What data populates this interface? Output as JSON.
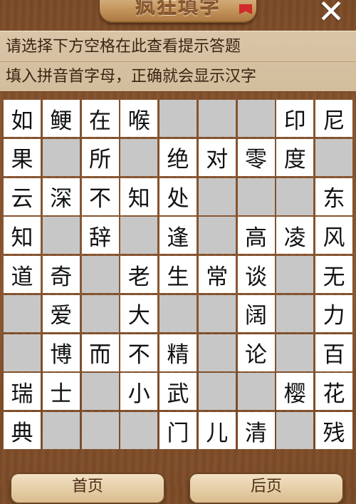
{
  "header": {
    "title": "疯狂填字",
    "close_label": "✕"
  },
  "hints": {
    "line1": "请选择下方空格在此查看提示答题",
    "line2": "填入拼音首字母，正确就会显示汉字"
  },
  "board": {
    "rows": [
      [
        "如",
        "鲠",
        "在",
        "喉",
        "",
        "",
        "",
        "印",
        "尼"
      ],
      [
        "果",
        "",
        "所",
        "",
        "绝",
        "对",
        "零",
        "度",
        ""
      ],
      [
        "云",
        "深",
        "不",
        "知",
        "处",
        "",
        "",
        "",
        "东"
      ],
      [
        "知",
        "",
        "辞",
        "",
        "逢",
        "",
        "高",
        "凌",
        "风"
      ],
      [
        "道",
        "奇",
        "",
        "老",
        "生",
        "常",
        "谈",
        "",
        "无"
      ],
      [
        "",
        "爱",
        "",
        "大",
        "",
        "",
        "阔",
        "",
        "力"
      ],
      [
        "",
        "博",
        "而",
        "不",
        "精",
        "",
        "论",
        "",
        "百"
      ],
      [
        "瑞",
        "士",
        "",
        "小",
        "武",
        "",
        "",
        "樱",
        "花"
      ],
      [
        "典",
        "",
        "",
        "",
        "门",
        "儿",
        "清",
        "",
        "残"
      ]
    ],
    "empty_cells": [
      [
        0,
        4
      ],
      [
        0,
        5
      ],
      [
        0,
        6
      ],
      [
        1,
        1
      ],
      [
        1,
        3
      ],
      [
        1,
        8
      ],
      [
        2,
        5
      ],
      [
        2,
        6
      ],
      [
        2,
        7
      ],
      [
        3,
        1
      ],
      [
        3,
        3
      ],
      [
        3,
        5
      ],
      [
        4,
        2
      ],
      [
        4,
        7
      ],
      [
        5,
        0
      ],
      [
        5,
        2
      ],
      [
        5,
        4
      ],
      [
        5,
        5
      ],
      [
        5,
        7
      ],
      [
        6,
        0
      ],
      [
        6,
        5
      ],
      [
        6,
        7
      ],
      [
        7,
        2
      ],
      [
        7,
        5
      ],
      [
        7,
        6
      ],
      [
        8,
        1
      ],
      [
        8,
        2
      ],
      [
        8,
        3
      ],
      [
        8,
        7
      ]
    ]
  },
  "buttons": {
    "prev": "首页",
    "next": "后页"
  },
  "colors": {
    "empty_cell": "#c7c7c7",
    "filled_cell": "#ffffff",
    "wood": "#7a4a26"
  }
}
